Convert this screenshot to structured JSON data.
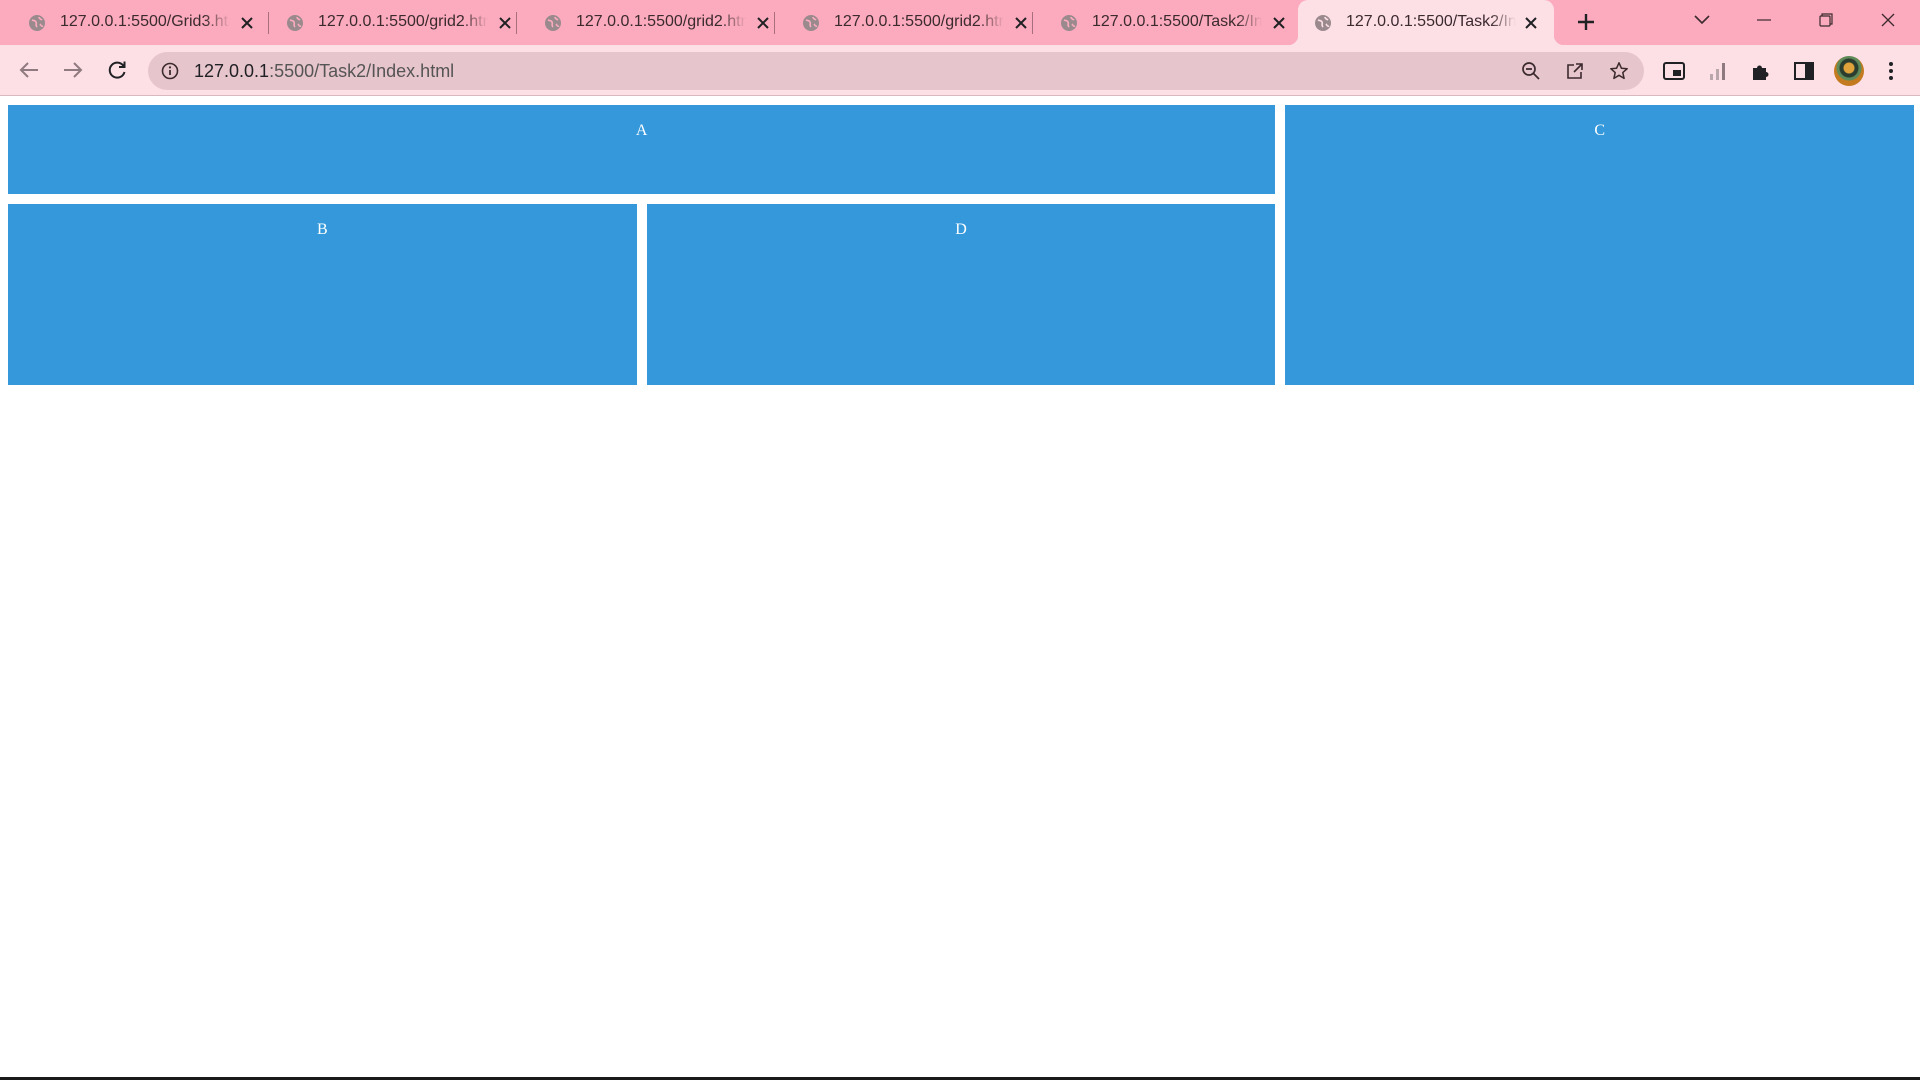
{
  "browser": {
    "tabs": [
      {
        "title": "127.0.0.1:5500/Grid3.html",
        "active": false
      },
      {
        "title": "127.0.0.1:5500/grid2.html",
        "active": false
      },
      {
        "title": "127.0.0.1:5500/grid2.html",
        "active": false
      },
      {
        "title": "127.0.0.1:5500/grid2.html",
        "active": false
      },
      {
        "title": "127.0.0.1:5500/Task2/Index.html",
        "active": false
      },
      {
        "title": "127.0.0.1:5500/Task2/Index.html",
        "active": true
      }
    ],
    "address": {
      "host": "127.0.0.1",
      "rest": ":5500/Task2/Index.html"
    },
    "colors": {
      "tabstrip": "#fbabbd",
      "toolbar": "#fde0e6",
      "omnibox": "#e7c5cc"
    },
    "icons": [
      "globe-icon",
      "close-icon",
      "plus-icon",
      "chevron-down-icon",
      "minimize-icon",
      "restore-icon",
      "window-close-icon",
      "back-icon",
      "forward-icon",
      "reload-icon",
      "info-icon",
      "zoom-out-icon",
      "share-icon",
      "star-icon",
      "picture-in-picture-icon",
      "performance-icon",
      "puzzle-icon",
      "side-panel-icon",
      "kebab-menu-icon"
    ]
  },
  "page": {
    "cells": {
      "a": "A",
      "b": "B",
      "c": "C",
      "d": "D"
    },
    "cell_color": "#3498db"
  }
}
